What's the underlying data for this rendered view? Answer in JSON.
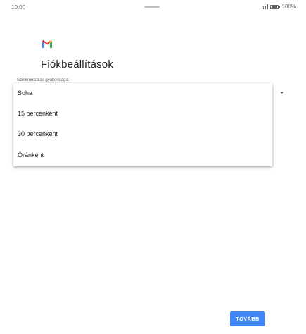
{
  "status_bar": {
    "time": "10:00",
    "battery_percent": "100%",
    "icons": [
      "signal-icon",
      "battery-icon"
    ]
  },
  "header": {
    "logo": "gmail-logo-icon",
    "title": "Fiókbeállítások"
  },
  "sync_setting": {
    "label": "Szinkronizálás gyakorisága:",
    "options": [
      "Soha",
      "15 percenként",
      "30 percenként",
      "Óránként"
    ],
    "dropdown_icon": "dropdown-arrow-icon"
  },
  "footer": {
    "next_label": "TOVÁBB"
  },
  "colors": {
    "accent": "#4285f4",
    "text_primary": "#202124",
    "text_secondary": "#5f6368",
    "gmail_red": "#ea4335",
    "gmail_blue": "#4285f4",
    "gmail_green": "#34a853",
    "gmail_yellow": "#fbbc04"
  }
}
